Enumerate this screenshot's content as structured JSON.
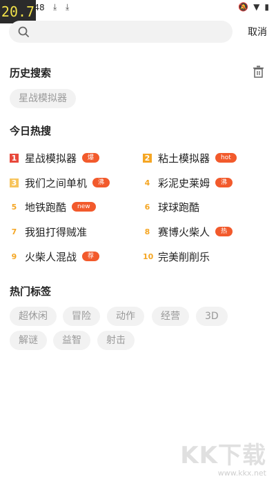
{
  "status_bar": {
    "time": "11:48",
    "fps": "20.7"
  },
  "search": {
    "placeholder": "",
    "cancel_label": "取消"
  },
  "history": {
    "title": "历史搜索",
    "items": [
      "星战模拟器"
    ]
  },
  "hot": {
    "title": "今日热搜",
    "items": [
      {
        "rank": "1",
        "name": "星战模拟器",
        "badge": "爆"
      },
      {
        "rank": "2",
        "name": "粘土模拟器",
        "badge": "hot"
      },
      {
        "rank": "3",
        "name": "我们之间单机",
        "badge": "沸"
      },
      {
        "rank": "4",
        "name": "彩泥史莱姆",
        "badge": "沸"
      },
      {
        "rank": "5",
        "name": "地铁跑酷",
        "badge": "new"
      },
      {
        "rank": "6",
        "name": "球球跑酷",
        "badge": ""
      },
      {
        "rank": "7",
        "name": "我狙打得贼准",
        "badge": ""
      },
      {
        "rank": "8",
        "name": "赛博火柴人",
        "badge": "热"
      },
      {
        "rank": "9",
        "name": "火柴人混战",
        "badge": "荐"
      },
      {
        "rank": "10",
        "name": "完美削削乐",
        "badge": ""
      }
    ]
  },
  "tags": {
    "title": "热门标签",
    "items": [
      "超休闲",
      "冒险",
      "动作",
      "经营",
      "3D",
      "解谜",
      "益智",
      "射击"
    ]
  },
  "watermark": {
    "logo": "KK下载",
    "url": "www.kkx.net"
  },
  "colors": {
    "accent": "#f25a2c",
    "rank1": "#e8483b",
    "rank2": "#f5a623",
    "chip_bg": "#f2f2f2"
  }
}
